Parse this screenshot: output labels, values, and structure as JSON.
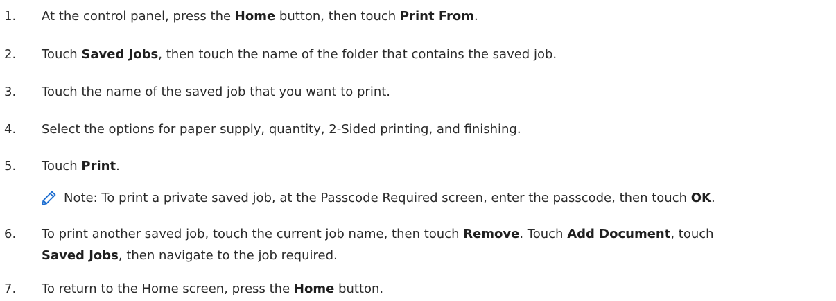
{
  "steps": [
    {
      "num": "1.",
      "t1": "At the control panel, press the ",
      "b1": "Home",
      "t2": " button, then touch ",
      "b2": "Print From",
      "t3": "."
    },
    {
      "num": "2.",
      "t1": "Touch ",
      "b1": "Saved Jobs",
      "t2": ", then touch the name of the folder that contains the saved job."
    },
    {
      "num": "3.",
      "t1": "Touch the name of the saved job that you want to print."
    },
    {
      "num": "4.",
      "t1": "Select the options for paper supply, quantity, 2-Sided printing, and finishing."
    },
    {
      "num": "5.",
      "t1": "Touch ",
      "b1": "Print",
      "t2": "."
    },
    {
      "num": "6.",
      "t1": "To print another saved job, touch the current job name, then touch ",
      "b1": "Remove",
      "t2": ". Touch ",
      "b2": "Add Document",
      "t3": ", touch",
      "b3": "Saved Jobs",
      "t4": ", then navigate to the job required."
    },
    {
      "num": "7.",
      "t1": "To return to the Home screen, press the ",
      "b1": "Home",
      "t2": " button."
    }
  ],
  "note": {
    "icon": "pencil-icon",
    "icon_color": "#1f6fd1",
    "t1": "Note: To print a private saved job, at the Passcode Required screen, enter the passcode, then touch ",
    "b1": "OK",
    "t2": "."
  }
}
